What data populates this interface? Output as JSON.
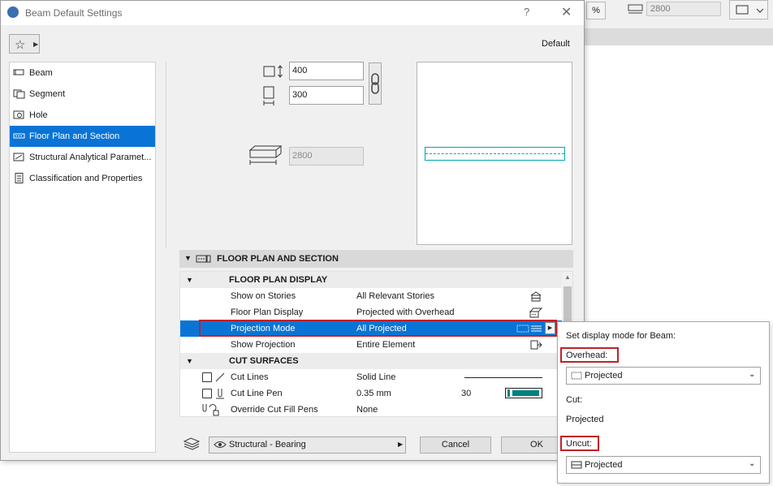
{
  "dialog": {
    "title": "Beam Default Settings",
    "help": "?",
    "close": "✕",
    "default_label": "Default"
  },
  "background_toolbar": {
    "percent_label": "%",
    "length_value": "2800"
  },
  "nav": {
    "items": [
      {
        "label": "Beam"
      },
      {
        "label": "Segment"
      },
      {
        "label": "Hole"
      },
      {
        "label": "Floor Plan and Section",
        "selected": true
      },
      {
        "label": "Structural Analytical Paramet..."
      },
      {
        "label": "Classification and Properties"
      }
    ]
  },
  "geometry": {
    "height_value": "400",
    "width_value": "300",
    "length_value": "2800"
  },
  "section": {
    "header": "FLOOR PLAN AND SECTION",
    "groups": [
      {
        "name": "FLOOR PLAN DISPLAY",
        "rows": [
          {
            "name": "Show on Stories",
            "value": "All Relevant Stories"
          },
          {
            "name": "Floor Plan Display",
            "value": "Projected with Overhead"
          },
          {
            "name": "Projection Mode",
            "value": "All Projected",
            "selected": true
          },
          {
            "name": "Show Projection",
            "value": "Entire Element"
          }
        ]
      },
      {
        "name": "CUT SURFACES",
        "rows": [
          {
            "name": "Cut Lines",
            "value": "Solid Line"
          },
          {
            "name": "Cut Line Pen",
            "value": "0.35 mm",
            "extra": "30"
          },
          {
            "name": "Override Cut Fill Pens",
            "value": "None"
          }
        ]
      }
    ]
  },
  "footer": {
    "layer": "Structural - Bearing",
    "cancel": "Cancel",
    "ok": "OK"
  },
  "popup": {
    "title": "Set display mode for Beam:",
    "overhead_label": "Overhead:",
    "overhead_value": "Projected",
    "cut_label": "Cut:",
    "cut_value": "Projected",
    "uncut_label": "Uncut:",
    "uncut_value": "Projected"
  },
  "colors": {
    "selection": "#0a74d6",
    "highlight_border": "#c0222a",
    "beam_preview": "#00a5b5",
    "pen_color": "#00827f"
  }
}
